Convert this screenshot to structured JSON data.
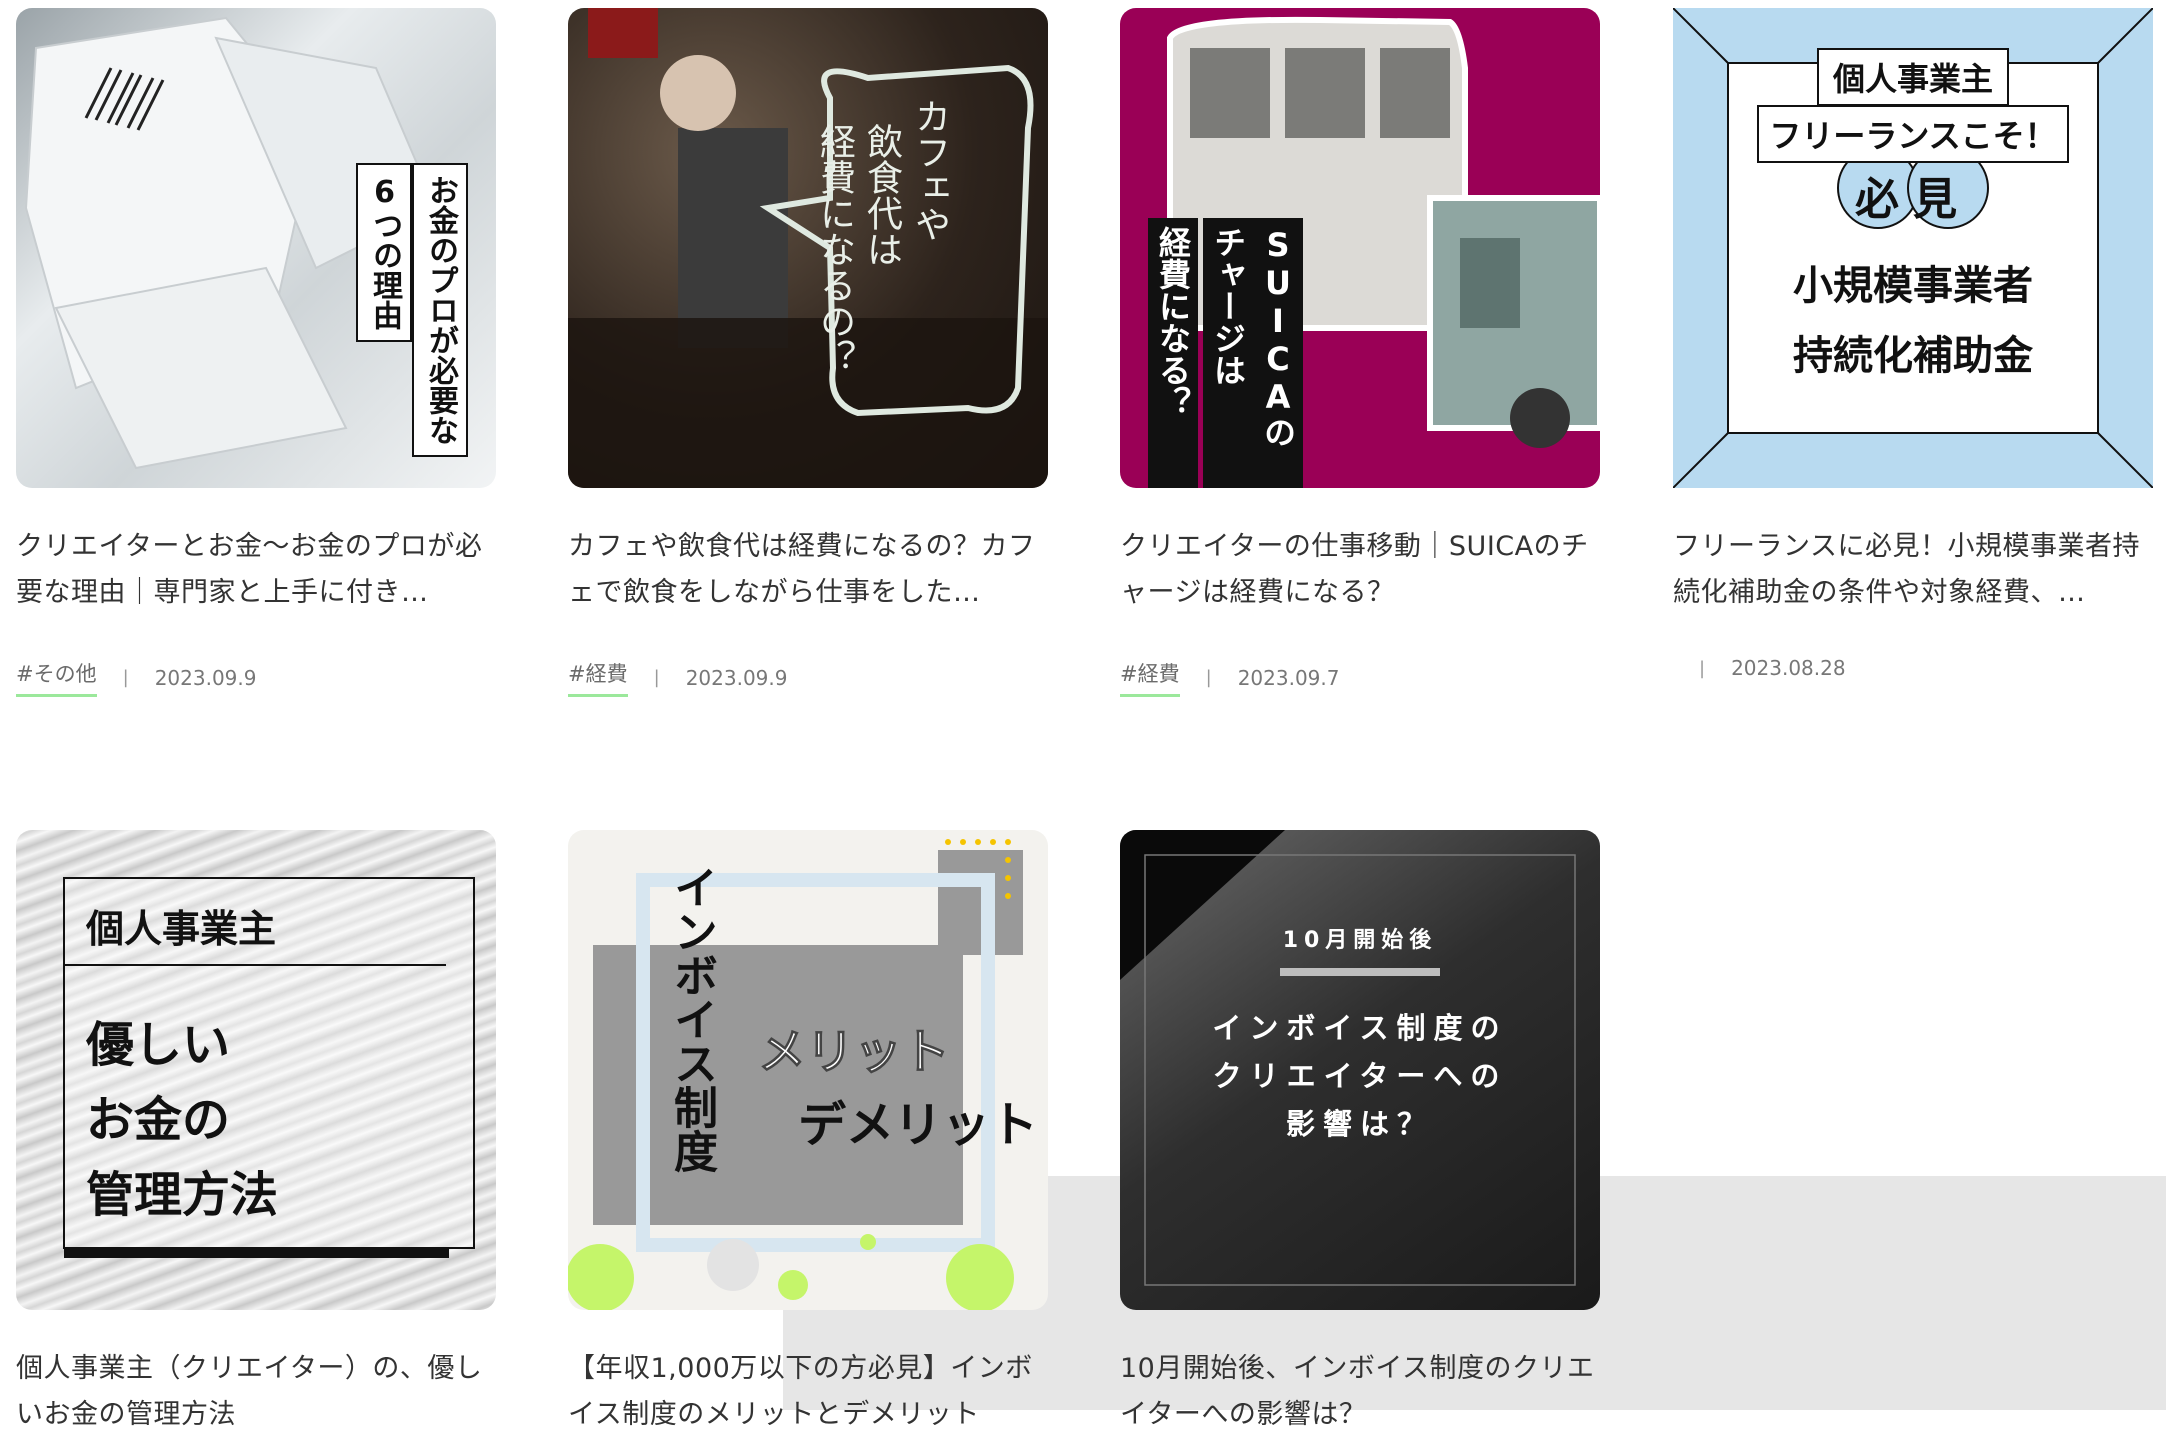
{
  "articles": [
    {
      "title": "クリエイターとお金〜お金のプロが必要な理由｜専門家と上手に付き…",
      "tag": "#その他",
      "date": "2023.09.9",
      "thumb": {
        "line1": "お金のプロが必要な",
        "line2": "6つの理由"
      }
    },
    {
      "title": "カフェや飲食代は経費になるの？カフェで飲食をしながら仕事をした…",
      "tag": "#経費",
      "date": "2023.09.9",
      "thumb": {
        "line1": "カフェや",
        "line2": "飲食代は",
        "line3": "経費になるの？"
      }
    },
    {
      "title": "クリエイターの仕事移動｜SUICAのチャージは経費になる？",
      "tag": "#経費",
      "date": "2023.09.7",
      "thumb": {
        "line1": "SUICAの",
        "line2": "チャージは",
        "line3": "経費になる？"
      }
    },
    {
      "title": "フリーランスに必見！小規模事業者持続化補助金の条件や対象経費、…",
      "tag": "",
      "date": "2023.08.28",
      "thumb": {
        "line1": "個人事業主",
        "line2": "フリーランスこそ！",
        "badge": "必見",
        "line3": "小規模事業者",
        "line4": "持続化補助金"
      }
    },
    {
      "title": "個人事業主（クリエイター）の、優しいお金の管理方法",
      "tag": "",
      "date": "",
      "thumb": {
        "line1": "個人事業主",
        "line2": "優しい",
        "line3": "お金の",
        "line4": "管理方法"
      }
    },
    {
      "title": "【年収1,000万以下の方必見】インボイス制度のメリットとデメリット",
      "tag": "",
      "date": "",
      "thumb": {
        "line1": "インボイス制度",
        "line2": "メリット",
        "line3": "デメリット"
      }
    },
    {
      "title": "10月開始後、インボイス制度のクリエイターへの影響は？",
      "tag": "",
      "date": "",
      "thumb": {
        "line1": "10月開始後",
        "line2": "インボイス制度の",
        "line3": "クリエイターへの",
        "line4": "影響は？"
      }
    }
  ],
  "colors": {
    "accent": "#9be89b",
    "magenta": "#9a0056",
    "lightblue": "#b8daf0"
  }
}
